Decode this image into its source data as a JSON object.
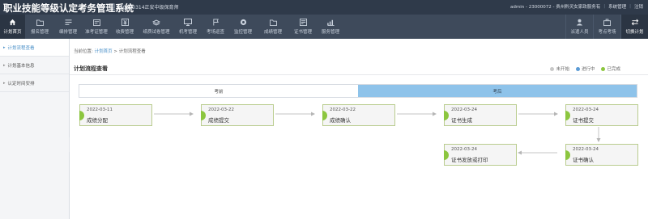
{
  "header": {
    "app_title": "职业技能等级认定考务管理系统",
    "plan_name": "20220314正安中级保育师",
    "user_info": "admin - 23000072 - 贵州黔灵女家政服务有",
    "system_manage": "系统管理",
    "logout": "注销",
    "separator": "|"
  },
  "nav": {
    "items": [
      {
        "label": "计划首页",
        "icon": "home-icon"
      },
      {
        "label": "报名管理",
        "icon": "folder-icon"
      },
      {
        "label": "编排管理",
        "icon": "list-icon"
      },
      {
        "label": "准考证管理",
        "icon": "ticket-icon"
      },
      {
        "label": "收费管理",
        "icon": "yen-icon"
      },
      {
        "label": "纸质试卷管理",
        "icon": "paper-stack-icon"
      },
      {
        "label": "机考管理",
        "icon": "monitor-icon"
      },
      {
        "label": "考场巡查",
        "icon": "flag-icon"
      },
      {
        "label": "监控管理",
        "icon": "camera-icon"
      },
      {
        "label": "成绩管理",
        "icon": "folder-icon"
      },
      {
        "label": "证书管理",
        "icon": "certificate-icon"
      },
      {
        "label": "服务管理",
        "icon": "chart-icon"
      }
    ],
    "right_items": [
      {
        "label": "派遣人员",
        "icon": "person-icon"
      },
      {
        "label": "考点考场",
        "icon": "briefcase-icon"
      },
      {
        "label": "切换计划",
        "icon": "switch-icon"
      }
    ]
  },
  "sidebar": {
    "items": [
      {
        "label": "计划流程查看"
      },
      {
        "label": "计划基本信息"
      },
      {
        "label": "认定时间安排"
      }
    ]
  },
  "main": {
    "breadcrumb": {
      "prefix": "当前位置:",
      "home": "计划首页",
      "sep": ">",
      "current": "计划流程查看"
    },
    "title": "计划流程查看",
    "legend": [
      {
        "label": "未开始",
        "color": "#c8c8c8"
      },
      {
        "label": "进行中",
        "color": "#5b9bd5"
      },
      {
        "label": "已完成",
        "color": "#8cc63f"
      }
    ],
    "phases": [
      {
        "label": "考前",
        "active": false
      },
      {
        "label": "考后",
        "active": true
      }
    ],
    "steps": [
      {
        "date": "2022-03-11",
        "name": "成绩分配"
      },
      {
        "date": "2022-03-22",
        "name": "成绩提交"
      },
      {
        "date": "2022-03-22",
        "name": "成绩确认"
      },
      {
        "date": "2022-03-24",
        "name": "证书生成"
      },
      {
        "date": "2022-03-24",
        "name": "证书提交"
      },
      {
        "date": "2022-03-24",
        "name": "证书确认"
      },
      {
        "date": "2022-03-24",
        "name": "证书发放或打印"
      }
    ],
    "colors": {
      "completed": "#8cc63f",
      "active_phase": "#8ec3ea",
      "link": "#4a90c8"
    }
  }
}
